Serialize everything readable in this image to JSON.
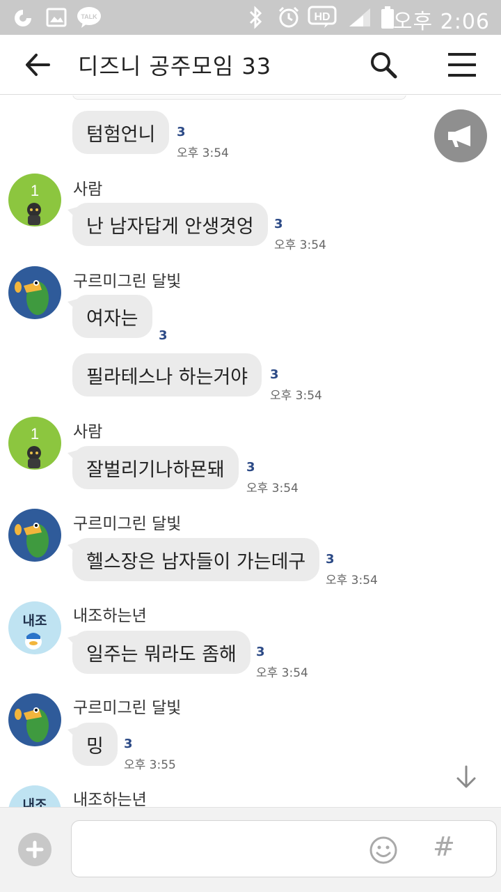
{
  "status_bar": {
    "time": "오후 2:06",
    "icons": [
      "olleh-icon",
      "gallery-notification-icon",
      "talk-notification-icon",
      "bluetooth-icon",
      "alarm-icon",
      "hd-voice-icon",
      "signal-icon",
      "battery-icon"
    ],
    "talk_badge": "TALK",
    "hd_label": "HD"
  },
  "header": {
    "title": "디즈니 공주모임 33"
  },
  "messages": [
    {
      "sender": "",
      "avatar": "",
      "text": "텀험언니",
      "unread": "3",
      "time": "오후 3:54"
    },
    {
      "sender": "사람",
      "avatar": "1",
      "text": "난 남자답게 안생겻엉",
      "unread": "3",
      "time": "오후 3:54"
    },
    {
      "sender": "구르미그린 달빛",
      "avatar": "",
      "text": "여자는",
      "unread": "3",
      "time": ""
    },
    {
      "sender": "",
      "avatar": "",
      "text": "필라테스나 하는거야",
      "unread": "3",
      "time": "오후 3:54"
    },
    {
      "sender": "사람",
      "avatar": "1",
      "text": "잘벌리기나하묜돼",
      "unread": "3",
      "time": "오후 3:54"
    },
    {
      "sender": "구르미그린 달빛",
      "avatar": "",
      "text": "헬스장은 남자들이 가는데구",
      "unread": "3",
      "time": "오후 3:54"
    },
    {
      "sender": "내조하는년",
      "avatar": "내조",
      "text": "일주는 뭐라도 좀해",
      "unread": "3",
      "time": "오후 3:54"
    },
    {
      "sender": "구르미그린 달빛",
      "avatar": "",
      "text": "밍",
      "unread": "3",
      "time": "오후 3:55"
    },
    {
      "sender": "내조하는년",
      "avatar": "내조",
      "text": "",
      "unread": "",
      "time": ""
    }
  ],
  "input": {
    "value": "",
    "placeholder": ""
  },
  "colors": {
    "status_bar": "#c9c9c9",
    "bubble": "#ebebeb",
    "unread": "#2c4a86",
    "avatar_green": "#8cc63f",
    "avatar_blue": "#2f5b9a",
    "avatar_light_blue": "#bfe3f2"
  }
}
